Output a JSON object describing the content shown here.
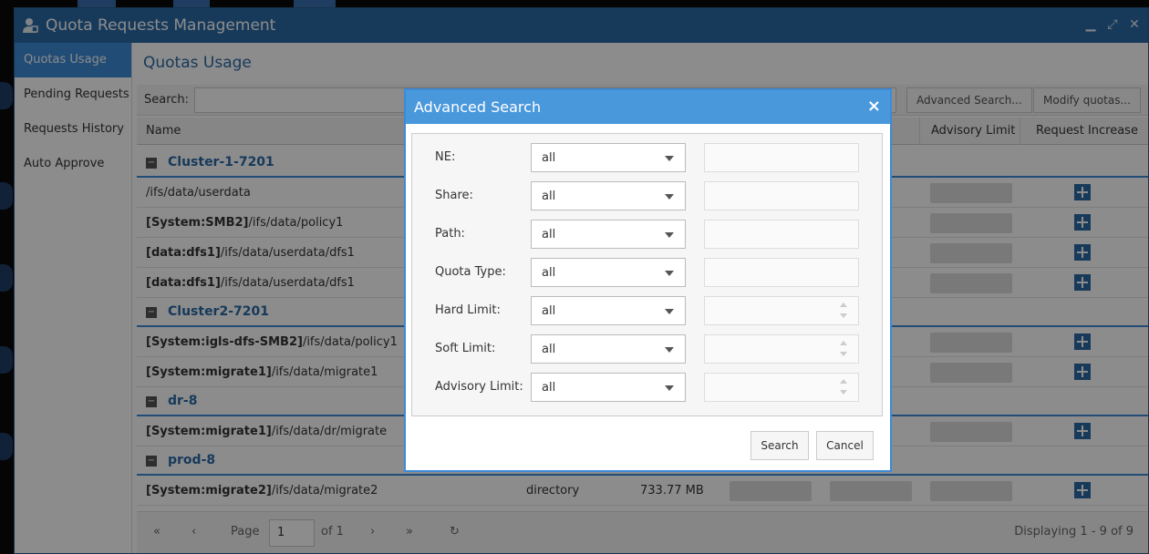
{
  "window": {
    "title": "Quota Requests Management",
    "controls": {
      "minimize": "minimize-icon",
      "maximize": "maximize-icon",
      "close": "close-icon"
    }
  },
  "sidebar": {
    "items": [
      {
        "label": "Quotas Usage",
        "active": true
      },
      {
        "label": "Pending Requests",
        "active": false
      },
      {
        "label": "Requests History",
        "active": false
      },
      {
        "label": "Auto Approve",
        "active": false
      }
    ]
  },
  "main": {
    "title": "Quotas Usage",
    "search_label": "Search:",
    "search_value": "",
    "advanced_search_label": "Advanced Search...",
    "modify_quotas_label": "Modify quotas..."
  },
  "grid": {
    "columns": {
      "name": "Name",
      "advisory_limit": "Advisory Limit",
      "request_increase": "Request Increase"
    },
    "groups": [
      {
        "name": "Cluster-1-7201",
        "toggle": "−",
        "rows": [
          {
            "prefix": "",
            "path": "/ifs/data/userdata"
          },
          {
            "prefix": "[System:SMB2]",
            "path": "/ifs/data/policy1"
          },
          {
            "prefix": "[data:dfs1]",
            "path": "/ifs/data/userdata/dfs1"
          },
          {
            "prefix": "[data:dfs1]",
            "path": "/ifs/data/userdata/dfs1"
          }
        ]
      },
      {
        "name": "Cluster2-7201",
        "toggle": "−",
        "rows": [
          {
            "prefix": "[System:igls-dfs-SMB2]",
            "path": "/ifs/data/policy1"
          },
          {
            "prefix": "[System:migrate1]",
            "path": "/ifs/data/migrate1"
          }
        ]
      },
      {
        "name": "dr-8",
        "toggle": "−",
        "rows": [
          {
            "prefix": "[System:migrate1]",
            "path": "/ifs/data/dr/migrate"
          }
        ]
      },
      {
        "name": "prod-8",
        "toggle": "−",
        "rows": [
          {
            "prefix": "[System:migrate2]",
            "path": "/ifs/data/migrate2",
            "type": "directory",
            "used": "733.77 MB"
          }
        ]
      }
    ]
  },
  "pager": {
    "page_label": "Page",
    "page_value": "1",
    "of_label": "of 1",
    "displaying": "Displaying 1 - 9 of 9"
  },
  "dialog": {
    "title": "Advanced Search",
    "close_glyph": "×",
    "fields": [
      {
        "label": "NE:",
        "value": "all",
        "spinner": false
      },
      {
        "label": "Share:",
        "value": "all",
        "spinner": false
      },
      {
        "label": "Path:",
        "value": "all",
        "spinner": false
      },
      {
        "label": "Quota Type:",
        "value": "all",
        "spinner": false
      },
      {
        "label": "Hard Limit:",
        "value": "all",
        "spinner": true
      },
      {
        "label": "Soft Limit:",
        "value": "all",
        "spinner": true
      },
      {
        "label": "Advisory Limit:",
        "value": "all",
        "spinner": true
      }
    ],
    "search_label": "Search",
    "cancel_label": "Cancel"
  },
  "colors": {
    "titlebar": "#2b6aa6",
    "accent": "#3d8ad6",
    "dialog_header": "#4a98dc"
  }
}
